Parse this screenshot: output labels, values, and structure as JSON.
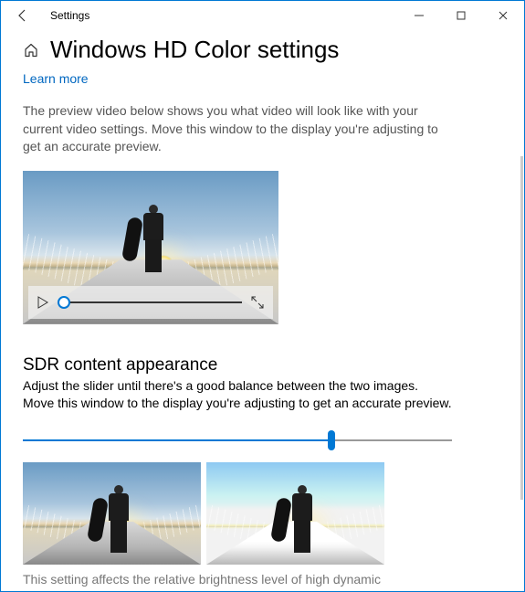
{
  "titlebar": {
    "app_name": "Settings"
  },
  "header": {
    "page_title": "Windows HD Color settings",
    "learn_more_label": "Learn more"
  },
  "preview": {
    "description": "The preview video below shows you what video will look like with your current video settings. Move this window to the display you're adjusting to get an accurate preview."
  },
  "sdr": {
    "heading": "SDR content appearance",
    "description": "Adjust the slider until there's a good balance between the two images. Move this window to the display you're adjusting to get an accurate preview.",
    "slider_value_percent": 72,
    "footer_note": "This setting affects the relative brightness level of high dynamic"
  }
}
